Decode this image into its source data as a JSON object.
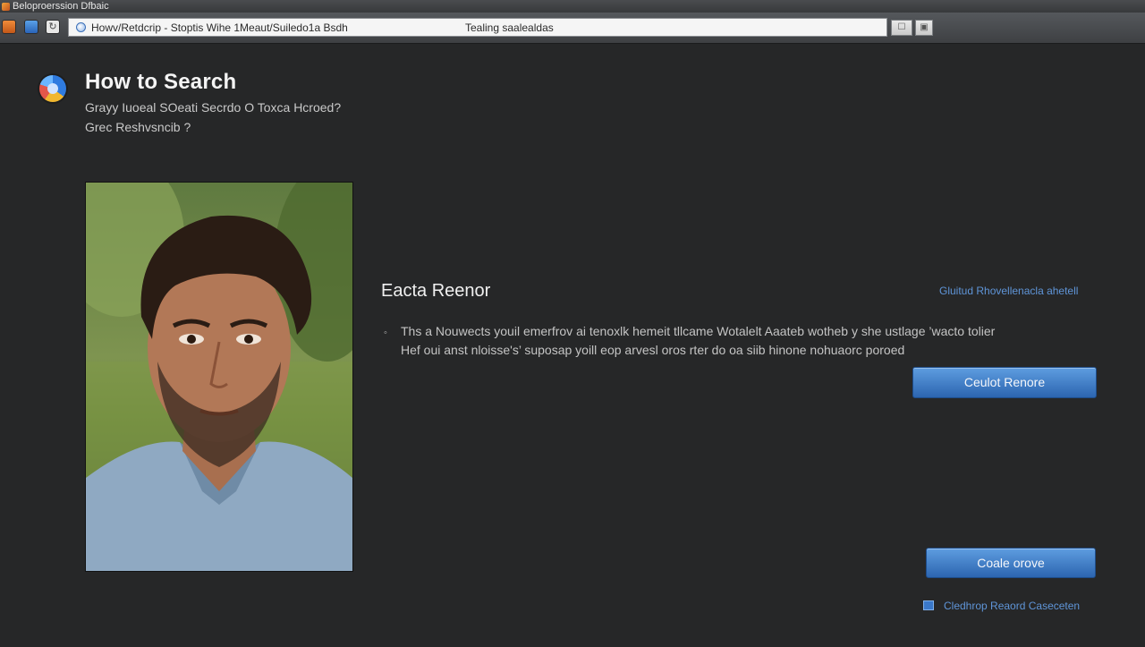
{
  "window": {
    "title": "Beloproerssion Dfbaic"
  },
  "toolbar": {
    "home_icon": "home-icon",
    "news_icon": "news-icon",
    "reload_icon": "reload-icon",
    "reload_glyph": "↻",
    "address": {
      "site_title": "Howv/Retdcrip - Stoptis Wihe 1Meaut/Suiledo1a Bsdh",
      "status": "Tealing saalealdas"
    },
    "bookmark_glyph": "☐",
    "menu_glyph": "▣"
  },
  "header": {
    "title": "How to Search",
    "subtitle_line1": "Grayy Iuoeal SOeati Secrdo O Toxca Hcroed?",
    "subtitle_line2": "Grec Reshvsncib ?"
  },
  "profile": {
    "name": "Eacta Reenor",
    "top_link": "Gluitud Rhovellenacla ahetell",
    "bullet": "◦",
    "description_line1": "Ths a Nouwects youil emerfrov ai tenoxlk hemeit tllcame Wotalelt Aaateb wotheb y she ustlage ’wacto tolier",
    "description_line2": "Hef oui anst nloisse's’ suposap yoill eop arvesl oros rter do oa siib hinone nohuaorc poroed",
    "primary_button": "Ceulot Renore",
    "secondary_button": "Coale orove",
    "footer_link": "Cledhrop Reaord Caseceten"
  },
  "colors": {
    "background": "#262728",
    "accent": "#2c65b0",
    "link": "#5f95d8"
  }
}
